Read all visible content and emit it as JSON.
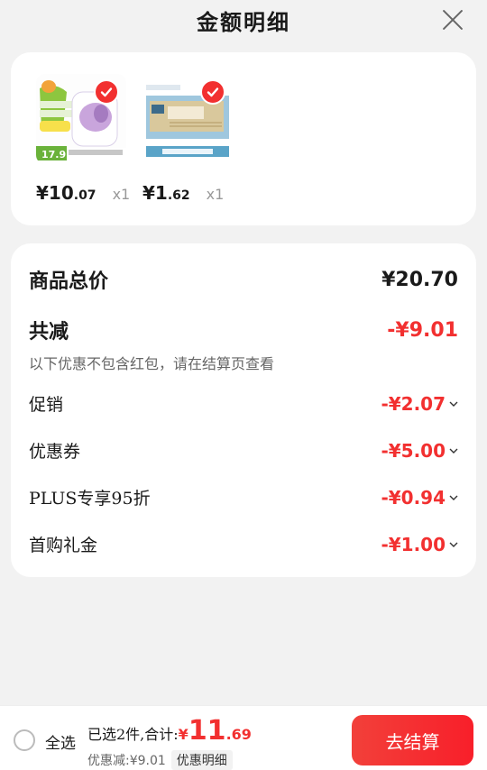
{
  "header": {
    "title": "金额明细"
  },
  "products": [
    {
      "price_int": "¥10",
      "price_dec": ".07",
      "qty": "x1"
    },
    {
      "price_int": "¥1",
      "price_dec": ".62",
      "qty": "x1"
    }
  ],
  "summary": {
    "total_label": "商品总价",
    "total_value": "¥20.70",
    "reduce_label": "共减",
    "reduce_value": "-¥9.01",
    "note": "以下优惠不包含红包，请在结算页查看",
    "items": [
      {
        "label": "促销",
        "value": "-¥2.07"
      },
      {
        "label": "优惠券",
        "value": "-¥5.00"
      },
      {
        "label": "PLUS专享95折",
        "value": "-¥0.94"
      },
      {
        "label": "首购礼金",
        "value": "-¥1.00"
      }
    ]
  },
  "bottom": {
    "select_all": "全选",
    "selected_text": "已选2件,合计:",
    "total_cur": "¥",
    "total_int": "11",
    "total_dec": ".69",
    "discount": "优惠减:¥9.01",
    "detail_button": "优惠明细",
    "checkout_button": "去结算"
  },
  "colors": {
    "accent": "#f23030",
    "background": "#f2f2f2"
  }
}
